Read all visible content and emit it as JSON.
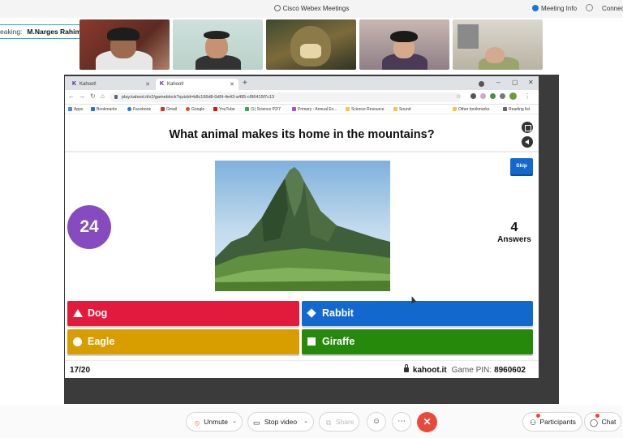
{
  "webex": {
    "title": "Cisco Webex Meetings",
    "meeting_info": "Meeting Info",
    "connect": "Connec",
    "speaking_label": "eaking:",
    "speaker_name": "M.Narges Rahimiparvar (C...",
    "controls": {
      "unmute": "Unmute",
      "stop_video": "Stop video",
      "share": "Share",
      "participants": "Participants",
      "chat": "Chat"
    }
  },
  "browser": {
    "tabs": [
      {
        "label": "Kahoot!"
      },
      {
        "label": "Kahoot!"
      }
    ],
    "url": "play.kahoot.it/v2/gameblock?quizId=b8c166d8-0d5f-4e43-a495-cf96415f7c13",
    "bookmarks": [
      "Apps",
      "Bookmarks",
      "Facebook",
      "Gmail",
      "Google",
      "YouTube",
      "(1) Science P2/7",
      "Primary - Annual Ex...",
      "Science Resource",
      "Sound",
      "Other bookmarks",
      "Reading list"
    ]
  },
  "kahoot": {
    "question": "What animal makes its home in the mountains?",
    "skip": "Skip",
    "timer": "24",
    "answers_count": "4",
    "answers_label": "Answers",
    "options": [
      {
        "label": "Dog",
        "color": "#e21b3c",
        "shape": "triangle"
      },
      {
        "label": "Rabbit",
        "color": "#1368ce",
        "shape": "diamond"
      },
      {
        "label": "Eagle",
        "color": "#d89e00",
        "shape": "circle"
      },
      {
        "label": "Giraffe",
        "color": "#26890c",
        "shape": "square"
      }
    ],
    "question_counter": "17/20",
    "site": "kahoot.it",
    "pin_label": "Game PIN:",
    "pin": "8960602"
  }
}
